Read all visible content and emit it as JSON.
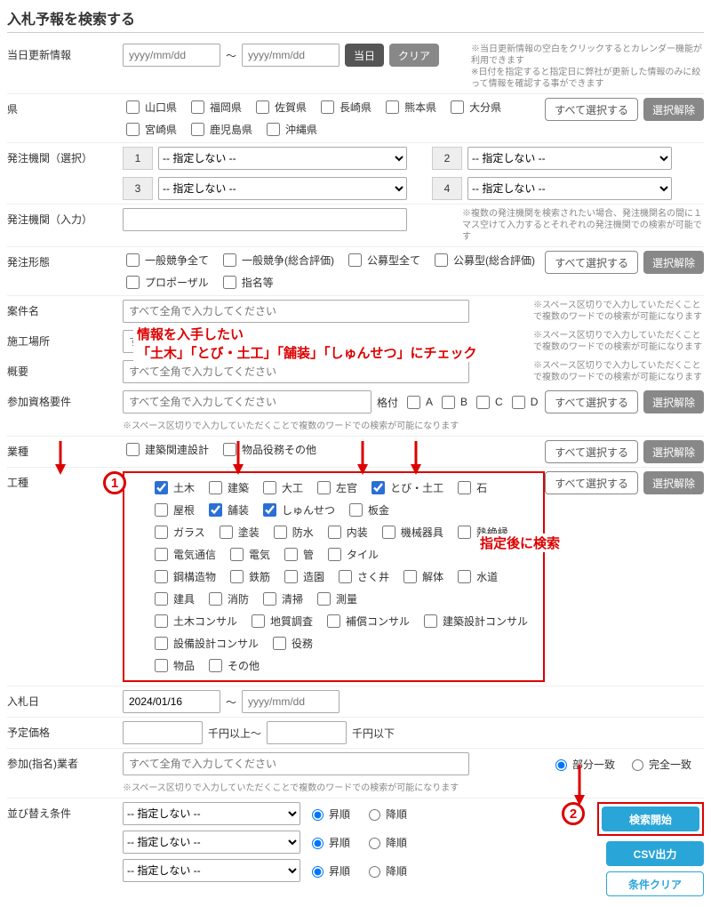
{
  "title": "入札予報を検索する",
  "rows": {
    "updateInfo": {
      "label": "当日更新情報",
      "ph_from": "yyyy/mm/dd",
      "tilde": "～",
      "ph_to": "yyyy/mm/dd",
      "btn_today": "当日",
      "btn_clear": "クリア",
      "note": "※当日更新情報の空白をクリックするとカレンダー機能が利用できます\n※日付を指定すると指定日に弊社が更新した情報のみに絞って情報を確認する事ができます"
    },
    "pref": {
      "label": "県",
      "items": [
        "山口県",
        "福岡県",
        "佐賀県",
        "長崎県",
        "熊本県",
        "大分県",
        "宮崎県",
        "鹿児島県",
        "沖縄県"
      ],
      "btn_all": "すべて選択する",
      "btn_clr": "選択解除"
    },
    "orgSel": {
      "label": "発注機関（選択）",
      "none": "-- 指定しない --",
      "nums": [
        "1",
        "2",
        "3",
        "4"
      ]
    },
    "orgInput": {
      "label": "発注機関（入力）",
      "ph": "",
      "note": "※複数の発注機関を検索されたい場合、発注機関名の間に１マス空けて入力するとそれぞれの発注機関での検索が可能です"
    },
    "orderType": {
      "label": "発注形態",
      "items": [
        "一般競争全て",
        "一般競争(総合評価)",
        "公募型全て",
        "公募型(総合評価)",
        "プロポーザル",
        "指名等"
      ],
      "btn_all": "すべて選択する",
      "btn_clr": "選択解除"
    },
    "caseName": {
      "label": "案件名",
      "ph": "すべて全角で入力してください",
      "note": "※スペース区切りで入力していただくことで複数のワードでの検索が可能になります"
    },
    "place": {
      "label": "施工場所",
      "ph": "すべて全角で入力してください",
      "note": "※スペース区切りで入力していただくことで複数のワードでの検索が可能になります"
    },
    "summary": {
      "label": "概要",
      "ph": "すべて全角で入力してください",
      "note": "※スペース区切りで入力していただくことで複数のワードでの検索が可能になります"
    },
    "qual": {
      "label": "参加資格要件",
      "ph": "すべて全角で入力してください",
      "grade": "格付",
      "grades": [
        "A",
        "B",
        "C",
        "D"
      ],
      "btn_all": "すべて選択する",
      "btn_clr": "選択解除",
      "note2": "※スペース区切りで入力していただくことで複数のワードでの検索が可能になります"
    },
    "industry": {
      "label": "業種",
      "items": [
        "建築関連設計",
        "物品役務その他"
      ],
      "btn_all": "すべて選択する",
      "btn_clr": "選択解除"
    },
    "workType": {
      "label": "工種",
      "btn_all": "すべて選択する",
      "btn_clr": "選択解除",
      "rows": [
        [
          {
            "l": "土木",
            "c": true
          },
          {
            "l": "建築"
          },
          {
            "l": "大工"
          },
          {
            "l": "左官"
          },
          {
            "l": "とび・土工",
            "c": true
          },
          {
            "l": "石"
          },
          {
            "l": "屋根"
          },
          {
            "l": "舗装",
            "c": true
          },
          {
            "l": "しゅんせつ",
            "c": true
          },
          {
            "l": "板金"
          }
        ],
        [
          {
            "l": "ガラス"
          },
          {
            "l": "塗装"
          },
          {
            "l": "防水"
          },
          {
            "l": "内装"
          },
          {
            "l": "機械器具"
          },
          {
            "l": "熱絶縁"
          },
          {
            "l": "電気通信"
          },
          {
            "l": "電気"
          },
          {
            "l": "管"
          },
          {
            "l": "タイル"
          }
        ],
        [
          {
            "l": "鋼構造物"
          },
          {
            "l": "鉄筋"
          },
          {
            "l": "造園"
          },
          {
            "l": "さく井"
          },
          {
            "l": "解体"
          },
          {
            "l": "水道"
          },
          {
            "l": "建具"
          },
          {
            "l": "消防"
          },
          {
            "l": "清掃"
          },
          {
            "l": "測量"
          }
        ],
        [
          {
            "l": "土木コンサル"
          },
          {
            "l": "地質調査"
          },
          {
            "l": "補償コンサル"
          },
          {
            "l": "建築設計コンサル"
          },
          {
            "l": "設備設計コンサル"
          },
          {
            "l": "役務"
          }
        ],
        [
          {
            "l": "物品"
          },
          {
            "l": "その他"
          }
        ]
      ]
    },
    "bidDate": {
      "label": "入札日",
      "from": "2024/01/16",
      "tilde": "～",
      "ph_to": "yyyy/mm/dd"
    },
    "estPrice": {
      "label": "予定価格",
      "mid1": "千円以上～",
      "mid2": "千円以下"
    },
    "nominee": {
      "label": "参加(指名)業者",
      "ph": "すべて全角で入力してください",
      "r1": "部分一致",
      "r2": "完全一致",
      "note": "※スペース区切りで入力していただくことで複数のワードでの検索が可能になります"
    },
    "sort": {
      "label": "並び替え条件",
      "sel": "-- 指定しない --",
      "asc": "昇順",
      "desc": "降順"
    },
    "actions": {
      "search": "検索開始",
      "csv": "CSV出力",
      "clear": "条件クリア"
    }
  },
  "anno": {
    "line1": "情報を入手したい",
    "line2": "「土木」「とび・土工」「舗装」「しゅんせつ」にチェック",
    "search": "指定後に検索",
    "c1": "1",
    "c2": "2"
  }
}
